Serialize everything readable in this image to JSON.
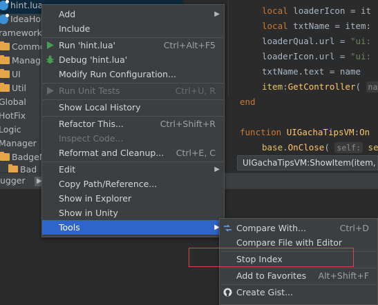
{
  "project_tree": {
    "items": [
      {
        "label": "hint.lua",
        "icon": "lua-file-icon"
      },
      {
        "label": "IdeaHot",
        "icon": "lua-file-icon"
      },
      {
        "label": "ramework",
        "icon": "none"
      },
      {
        "label": "Commo",
        "icon": "folder-icon"
      },
      {
        "label": "Manage",
        "icon": "folder-icon"
      },
      {
        "label": "UI",
        "icon": "folder-icon"
      },
      {
        "label": "Util",
        "icon": "folder-icon"
      },
      {
        "label": "Global",
        "icon": "none"
      },
      {
        "label": "HotFix",
        "icon": "none"
      },
      {
        "label": "Logic",
        "icon": "none"
      },
      {
        "label": "Manager",
        "icon": "none"
      },
      {
        "label": "BadgeM",
        "icon": "folder-icon"
      },
      {
        "label": "Bad",
        "icon": "folder-icon"
      }
    ]
  },
  "bottom_panel": {
    "tab_label": "ugger",
    "button_glyph": "▶"
  },
  "editor": {
    "lines": [
      {
        "kw": "local",
        "rest": " loaderIcon = it"
      },
      {
        "kw": "local",
        "rest": " txtName = item:"
      },
      {
        "name": "loaderQual.url = ",
        "str": "\"ui:"
      },
      {
        "name": "loaderIcon.url = ",
        "str": "\"ui:"
      },
      {
        "name": "txtName.text = name"
      },
      {
        "obj": "item",
        "colon": ":",
        "fn": "GetController",
        "paren": "(",
        "hint": "na"
      },
      {
        "kw": "end"
      },
      {
        "kw": "function",
        "fn": " UIGachaTipsVM",
        "colon": ":",
        "fn2": "On"
      },
      {
        "obj": "base",
        "dot": ".",
        "fn": "OnClose",
        "paren": "(",
        "hint": "self:",
        "rest": " se"
      }
    ],
    "tooltip": "UIGachaTipsVM:ShowItem(item, s"
  },
  "context_menu": {
    "items": [
      {
        "label": "Add",
        "submenu": true
      },
      {
        "label": "Include"
      },
      {
        "label": "Run 'hint.lua'",
        "shortcut": "Ctrl+Alt+F5",
        "icon": "run-icon"
      },
      {
        "label": "Debug 'hint.lua'",
        "icon": "debug-icon"
      },
      {
        "label": "Modify Run Configuration..."
      },
      {
        "label": "Run Unit Tests",
        "shortcut": "Ctrl+U, R",
        "disabled": true,
        "icon": "run-icon"
      },
      {
        "label": "Show Local History"
      },
      {
        "label": "Refactor This...",
        "shortcut": "Ctrl+Shift+R"
      },
      {
        "label": "Inspect Code...",
        "disabled": true
      },
      {
        "label": "Reformat and Cleanup...",
        "shortcut": "Ctrl+E, C"
      },
      {
        "label": "Edit",
        "submenu": true
      },
      {
        "label": "Copy Path/Reference..."
      },
      {
        "label": "Show in Explorer"
      },
      {
        "label": "Show in Unity"
      },
      {
        "label": "Tools",
        "submenu": true,
        "selected": true
      }
    ]
  },
  "tools_submenu": {
    "items": [
      {
        "label": "Compare With...",
        "shortcut": "Ctrl+D",
        "icon": "compare-icon"
      },
      {
        "label": "Compare File with Editor"
      },
      {
        "label": "Stop Index",
        "highlighted": true
      },
      {
        "label": "Add to Favorites",
        "shortcut": "Alt+Shift+F"
      },
      {
        "label": "Create Gist...",
        "icon": "github-icon"
      }
    ]
  },
  "colors": {
    "menu_bg": "#3c3f41",
    "selection": "#2f65ca",
    "highlight_box": "#d9474b",
    "keyword": "#cc7832",
    "function": "#ffc66d",
    "string": "#6a8759"
  }
}
